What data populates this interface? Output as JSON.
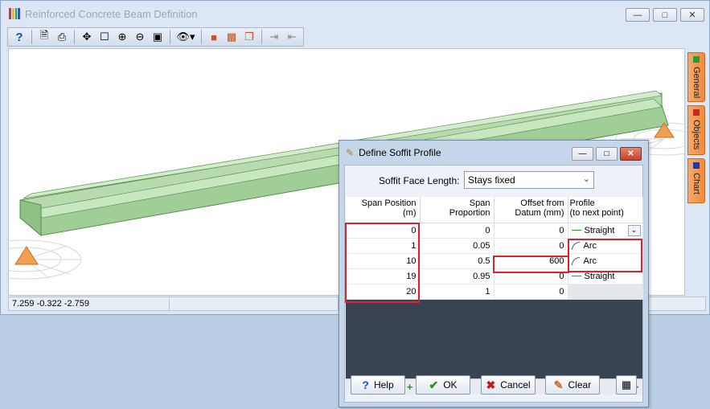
{
  "main_window": {
    "title": "Reinforced Concrete Beam Definition",
    "status": {
      "coords": "7.259  -0.322  -2.759"
    },
    "side_tabs": [
      {
        "label": "General",
        "color": "#2e9a2e"
      },
      {
        "label": "Objects",
        "color": "#c8281e"
      },
      {
        "label": "Chart",
        "color": "#1e3aa8"
      }
    ]
  },
  "dialog": {
    "title": "Define Soffit Profile",
    "soffit_face_length_label": "Soffit Face Length:",
    "soffit_face_length_value": "Stays fixed",
    "columns": {
      "span_position": [
        "Span Position",
        "(m)"
      ],
      "span_proportion": [
        "Span",
        "Proportion"
      ],
      "offset": [
        "Offset from",
        "Datum (mm)"
      ],
      "profile": [
        "Profile",
        "(to next point)"
      ]
    },
    "rows": [
      {
        "span_position": "0",
        "proportion": "0",
        "offset": "0",
        "profile": "Straight",
        "profile_icon": "line"
      },
      {
        "span_position": "1",
        "proportion": "0.05",
        "offset": "0",
        "profile": "Arc",
        "profile_icon": "arc"
      },
      {
        "span_position": "10",
        "proportion": "0.5",
        "offset": "600",
        "profile": "Arc",
        "profile_icon": "arc"
      },
      {
        "span_position": "19",
        "proportion": "0.95",
        "offset": "0",
        "profile": "Straight",
        "profile_icon": "line"
      },
      {
        "span_position": "20",
        "proportion": "1",
        "offset": "0",
        "profile": "",
        "profile_icon": ""
      }
    ],
    "buttons": {
      "help": "Help",
      "ok": "OK",
      "cancel": "Cancel",
      "clear": "Clear"
    }
  },
  "colors": {
    "beam": "#a8d4a0",
    "support": "#f0a050",
    "highlight": "#e0202a"
  }
}
